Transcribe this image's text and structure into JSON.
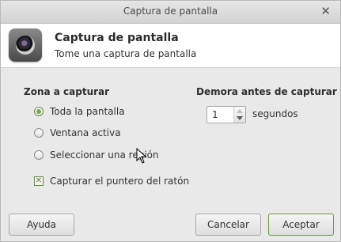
{
  "window": {
    "title": "Captura de pantalla",
    "close_glyph": "✕"
  },
  "header": {
    "title": "Captura de pantalla",
    "subtitle": "Tome una captura de pantalla",
    "icon": "camera-icon"
  },
  "capture_area": {
    "heading": "Zona a capturar",
    "options": [
      {
        "label": "Toda la pantalla",
        "selected": true
      },
      {
        "label": "Ventana activa",
        "selected": false
      },
      {
        "label": "Seleccionar una región",
        "selected": false
      }
    ],
    "pointer_checkbox": {
      "label": "Capturar el puntero del ratón",
      "checked": true,
      "glyph": "✕"
    }
  },
  "delay": {
    "heading": "Demora antes de capturar",
    "value": "1",
    "unit": "segundos"
  },
  "buttons": {
    "help": "Ayuda",
    "cancel": "Cancelar",
    "accept": "Aceptar"
  }
}
